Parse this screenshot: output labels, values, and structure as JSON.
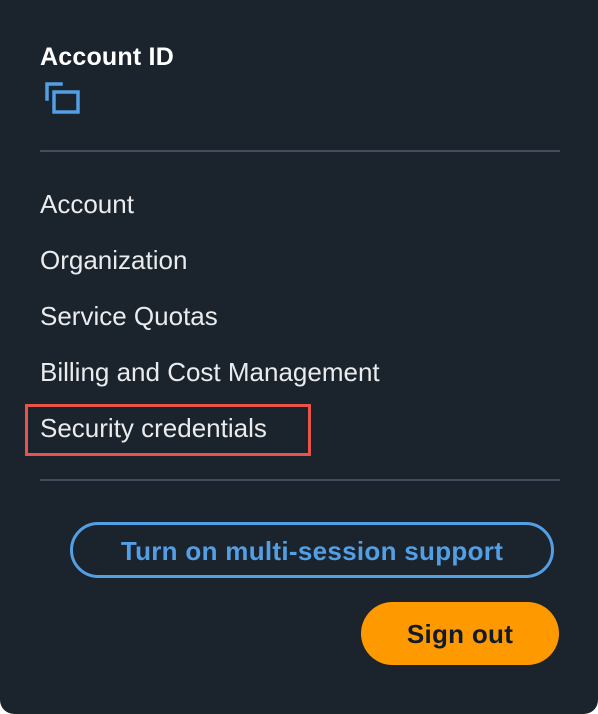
{
  "account": {
    "title": "Account ID",
    "copy_icon": "copy-icon"
  },
  "menu": {
    "items": [
      {
        "label": "Account"
      },
      {
        "label": "Organization"
      },
      {
        "label": "Service Quotas"
      },
      {
        "label": "Billing and Cost Management"
      },
      {
        "label": "Security credentials",
        "highlighted": true
      }
    ]
  },
  "actions": {
    "multi_session_label": "Turn on multi-session support",
    "signout_label": "Sign out"
  },
  "colors": {
    "panel_background": "#1b232d",
    "text": "#e9ebed",
    "divider": "#414d5c",
    "link_blue": "#539fe5",
    "signout_orange": "#ff9900",
    "highlight_red": "#e8534a"
  }
}
